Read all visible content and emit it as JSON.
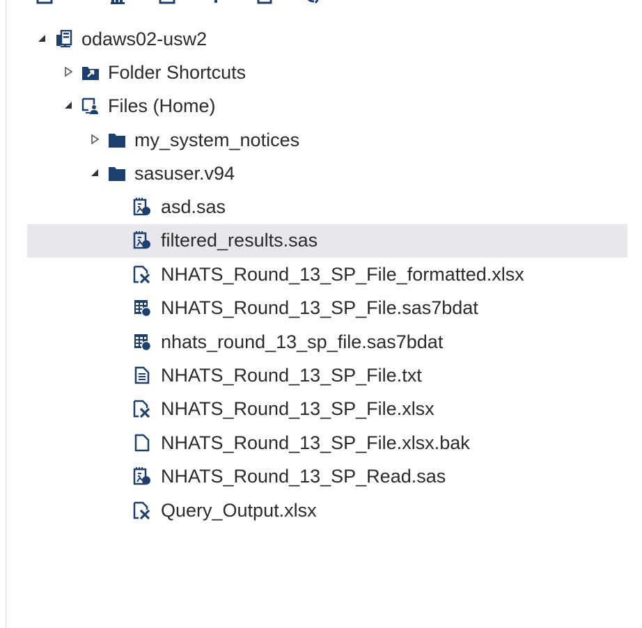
{
  "toolbar": {
    "icons": [
      "new-icon",
      "library-icon",
      "save-icon",
      "upload-icon",
      "properties-icon",
      "refresh-icon"
    ]
  },
  "tree": {
    "server": {
      "label": "odaws02-usw2",
      "icon": "server-icon",
      "expanded": true
    },
    "folder_shortcuts": {
      "label": "Folder Shortcuts",
      "icon": "folder-shortcut-icon",
      "expanded": false
    },
    "files_home": {
      "label": "Files (Home)",
      "icon": "home-files-icon",
      "expanded": true
    },
    "folders": [
      {
        "label": "my_system_notices",
        "icon": "folder-icon",
        "expanded": false
      },
      {
        "label": "sasuser.v94",
        "icon": "folder-icon",
        "expanded": true
      }
    ],
    "files": [
      {
        "label": "asd.sas",
        "icon": "sas-program-icon",
        "selected": false
      },
      {
        "label": "filtered_results.sas",
        "icon": "sas-program-icon",
        "selected": true
      },
      {
        "label": "NHATS_Round_13_SP_File_formatted.xlsx",
        "icon": "excel-file-icon",
        "selected": false
      },
      {
        "label": "NHATS_Round_13_SP_File.sas7bdat",
        "icon": "sas-dataset-icon",
        "selected": false
      },
      {
        "label": "nhats_round_13_sp_file.sas7bdat",
        "icon": "sas-dataset-icon",
        "selected": false
      },
      {
        "label": "NHATS_Round_13_SP_File.txt",
        "icon": "text-file-icon",
        "selected": false
      },
      {
        "label": "NHATS_Round_13_SP_File.xlsx",
        "icon": "excel-file-icon",
        "selected": false
      },
      {
        "label": "NHATS_Round_13_SP_File.xlsx.bak",
        "icon": "blank-file-icon",
        "selected": false
      },
      {
        "label": "NHATS_Round_13_SP_Read.sas",
        "icon": "sas-program-icon",
        "selected": false
      },
      {
        "label": "Query_Output.xlsx",
        "icon": "excel-file-icon",
        "selected": false
      }
    ]
  },
  "colors": {
    "icon": "#1d3f6e",
    "selection": "#e8e8ec",
    "text": "#2a2a2a",
    "toggle": "#555555"
  }
}
